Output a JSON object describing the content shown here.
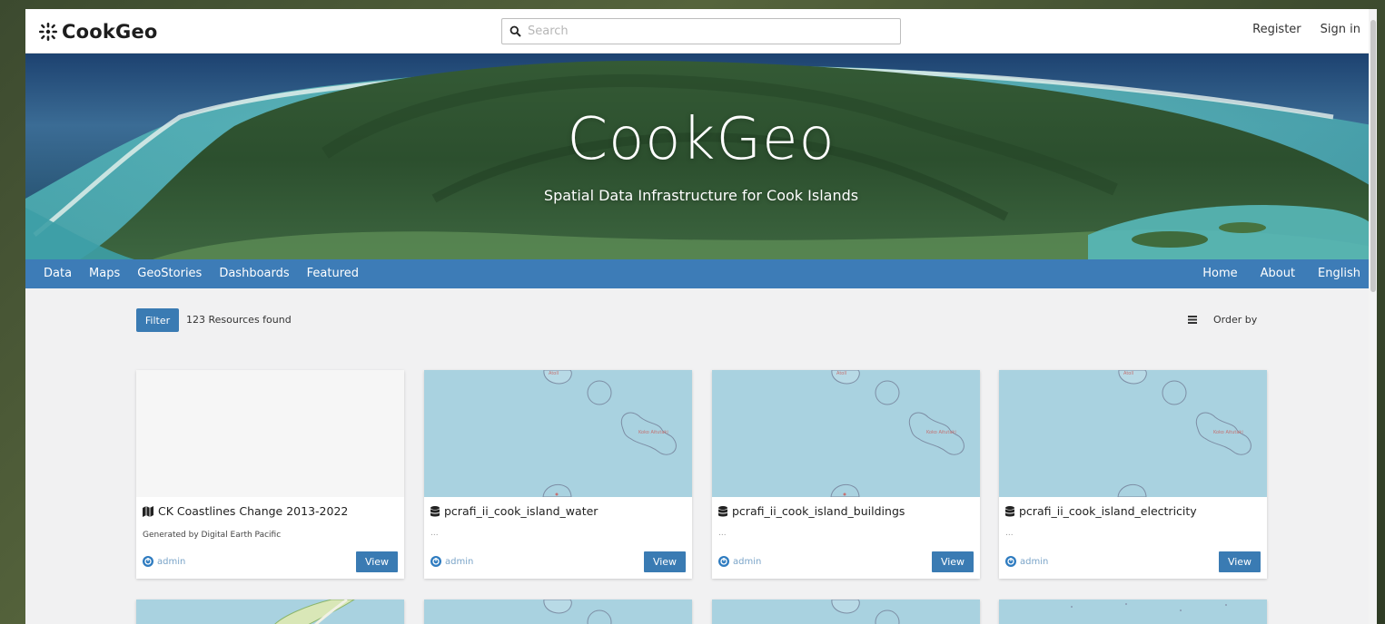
{
  "header": {
    "logo_text": "CookGeo",
    "search_placeholder": "Search",
    "register_label": "Register",
    "signin_label": "Sign in"
  },
  "hero": {
    "title": "CookGeo",
    "subtitle": "Spatial Data Infrastructure for Cook Islands"
  },
  "nav": {
    "left": [
      "Data",
      "Maps",
      "GeoStories",
      "Dashboards",
      "Featured"
    ],
    "right": [
      "Home",
      "About",
      "English"
    ]
  },
  "toolbar": {
    "filter_label": "Filter",
    "results_text": "123 Resources found",
    "order_label": "Order by"
  },
  "cards": [
    {
      "icon": "map-icon",
      "title": "CK Coastlines Change 2013-2022",
      "description": "Generated by Digital Earth Pacific",
      "owner": "admin",
      "view_label": "View"
    },
    {
      "icon": "database-icon",
      "title": "pcrafi_ii_cook_island_water",
      "description": "...",
      "owner": "admin",
      "view_label": "View",
      "map_label": "Koko Aitutaki"
    },
    {
      "icon": "database-icon",
      "title": "pcrafi_ii_cook_island_buildings",
      "description": "...",
      "owner": "admin",
      "view_label": "View",
      "map_label": "Koko Aitutaki"
    },
    {
      "icon": "database-icon",
      "title": "pcrafi_ii_cook_island_electricity",
      "description": "...",
      "owner": "admin",
      "view_label": "View",
      "map_label": "Koko Aitutaki"
    }
  ],
  "map_tiny_label": "Atoll",
  "colors": {
    "primary": "#3a7bb3",
    "nav_bar": "#3d7cb7",
    "map_water": "#a9d2e0",
    "owner_text": "#7aa4c8"
  }
}
